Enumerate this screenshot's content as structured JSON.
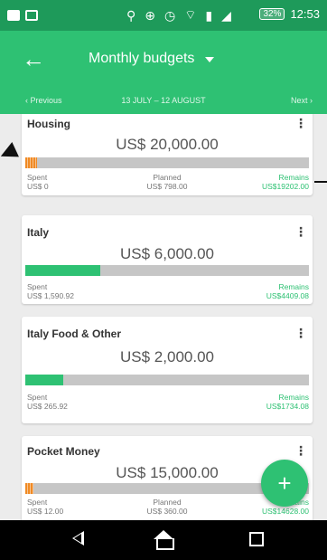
{
  "status_bar": {
    "time": "12:53",
    "battery": "32%"
  },
  "app_bar": {
    "title": "Monthly budgets",
    "back_icon": "arrow-left-icon",
    "dropdown_icon": "caret-down-icon"
  },
  "period": {
    "previous": "‹ Previous",
    "range": "13 JULY – 12 AUGUST",
    "next": "Next ›"
  },
  "colors": {
    "primary": "#2ec173",
    "status_bar": "#1e9a5a",
    "progress_track": "#c6c6c6",
    "overspend_warning": "#f08a24",
    "remains_text": "#2ec173"
  },
  "budgets": [
    {
      "name": "Housing",
      "amount": "US$ 20,000.00",
      "progress": 0.04,
      "progress_color": "orange",
      "spent_label": "Spent",
      "spent_value": "US$ 0",
      "planned_label": "Planned",
      "planned_value": "US$ 798.00",
      "remains_label": "Remains",
      "remains_value": "US$19202.00"
    },
    {
      "name": "Italy",
      "amount": "US$ 6,000.00",
      "progress": 0.265,
      "progress_color": "green",
      "spent_label": "Spent",
      "spent_value": "US$ 1,590.92",
      "remains_label": "Remains",
      "remains_value": "US$4409.08"
    },
    {
      "name": "Italy Food & Other",
      "amount": "US$ 2,000.00",
      "progress": 0.133,
      "progress_color": "green",
      "spent_label": "Spent",
      "spent_value": "US$ 265.92",
      "remains_label": "Remains",
      "remains_value": "US$1734.08"
    },
    {
      "name": "Pocket Money",
      "amount": "US$ 15,000.00",
      "progress": 0.03,
      "progress_color": "orange",
      "spent_label": "Spent",
      "spent_value": "US$ 12.00",
      "planned_label": "Planned",
      "planned_value": "US$ 360.00",
      "remains_label": "Remains",
      "remains_value": "US$14628.00"
    }
  ],
  "fab": {
    "label": "+"
  }
}
